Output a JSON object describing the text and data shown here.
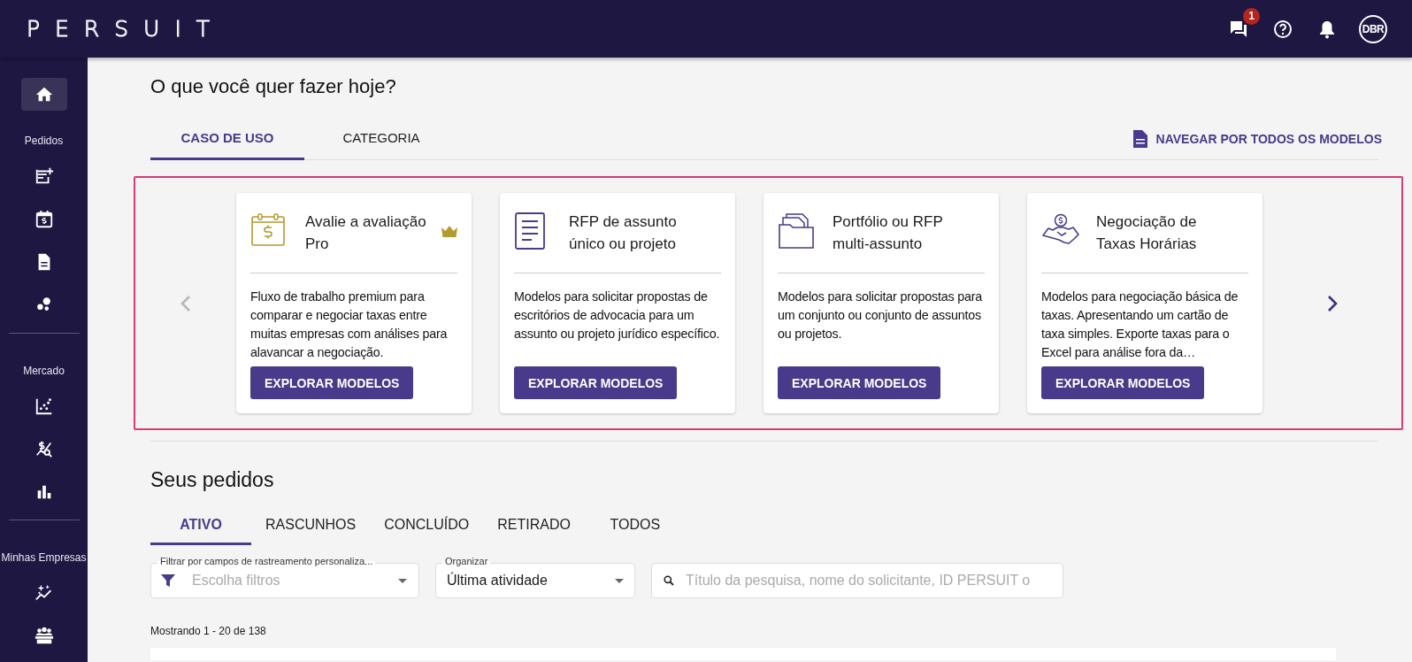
{
  "header": {
    "logo": "PERSUIT",
    "messages": {
      "badge": "1"
    },
    "avatar": "DBR"
  },
  "sidebar": {
    "home": {
      "selected": true
    },
    "sections": [
      {
        "label": "Pedidos",
        "items": [
          {
            "selected": false
          },
          {
            "selected": false
          },
          {
            "selected": false
          },
          {
            "selected": false
          }
        ]
      },
      {
        "label": "Mercado",
        "items": [
          {
            "selected": false
          },
          {
            "selected": false
          },
          {
            "selected": false
          }
        ]
      },
      {
        "label": "Minhas Empresas",
        "items": [
          {
            "selected": false
          },
          {
            "selected": false
          }
        ]
      }
    ]
  },
  "heading": "O que você quer fazer hoje?",
  "template_tabs": [
    {
      "label": "CASO DE USO",
      "selected": true
    },
    {
      "label": "CATEGORIA",
      "selected": false
    }
  ],
  "browse_link": "NAVEGAR POR TODOS OS MODELOS",
  "carousel": {
    "previous": {
      "disabled": true
    },
    "next": {
      "disabled": false
    },
    "cards": [
      {
        "title": "Avalie a avaliação Pro",
        "premium": true,
        "description": "Fluxo de trabalho premium para comparar e negociar taxas entre muitas empresas com análises para alavancar a negociação.",
        "button": "EXPLORAR MODELOS"
      },
      {
        "title": "RFP de assunto único ou projeto",
        "premium": false,
        "description": "Modelos para solicitar propostas de escritórios de advocacia para um assunto ou projeto jurídico específico.",
        "button": "EXPLORAR MODELOS"
      },
      {
        "title": "Portfólio ou RFP multi-assunto",
        "premium": false,
        "description": "Modelos para solicitar propostas para um conjunto ou conjunto de assuntos ou projetos.",
        "button": "EXPLORAR MODELOS"
      },
      {
        "title": "Negociação de Taxas Horárias",
        "premium": false,
        "description": "Modelos para negociação básica de taxas. Apresentando um cartão de taxa simples. Exporte taxas para o Excel para análise fora da…",
        "button": "EXPLORAR MODELOS"
      }
    ]
  },
  "requests_heading": "Seus pedidos",
  "request_tabs": [
    {
      "label": "ATIVO",
      "selected": true
    },
    {
      "label": "RASCUNHOS",
      "selected": false
    },
    {
      "label": "CONCLUÍDO",
      "selected": false
    },
    {
      "label": "RETIRADO",
      "selected": false
    },
    {
      "label": "TODOS",
      "selected": false
    }
  ],
  "filter": {
    "label": "Filtrar por campos de rastreamento personaliza...",
    "placeholder": "Escolha filtros"
  },
  "sort": {
    "label": "Organizar",
    "value": "Última atividade"
  },
  "search": {
    "placeholder": "Título da pesquisa, nome do solicitante, ID PERSUIT o"
  },
  "showing": "Mostrando 1 - 20 de 138"
}
